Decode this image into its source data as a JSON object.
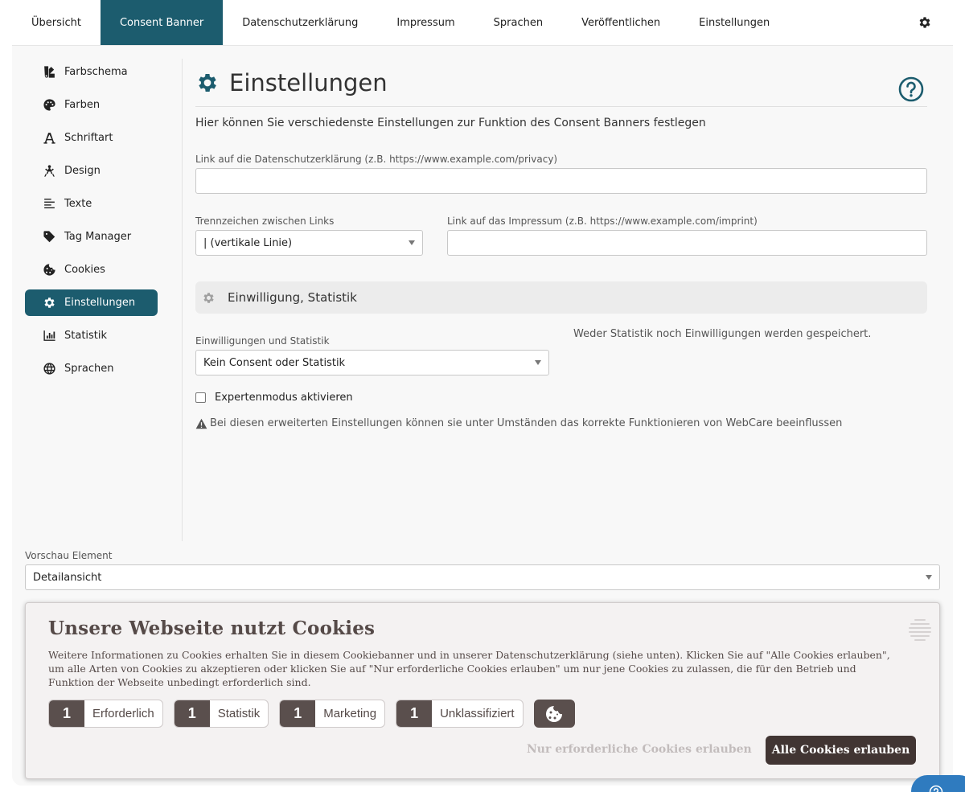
{
  "topnav": {
    "tabs": [
      {
        "label": "Übersicht"
      },
      {
        "label": "Consent Banner"
      },
      {
        "label": "Datenschutzerklärung"
      },
      {
        "label": "Impressum"
      },
      {
        "label": "Sprachen"
      },
      {
        "label": "Veröffentlichen"
      },
      {
        "label": "Einstellungen"
      }
    ],
    "active_tab": "Consent Banner",
    "settings_icon": "gear-icon"
  },
  "sidebar": {
    "items": [
      {
        "label": "Farbschema",
        "icon": "swatch-icon"
      },
      {
        "label": "Farben",
        "icon": "palette-icon"
      },
      {
        "label": "Schriftart",
        "icon": "font-icon"
      },
      {
        "label": "Design",
        "icon": "compass-drafting-icon"
      },
      {
        "label": "Texte",
        "icon": "align-left-icon"
      },
      {
        "label": "Tag Manager",
        "icon": "tag-icon"
      },
      {
        "label": "Cookies",
        "icon": "cookie-icon"
      },
      {
        "label": "Einstellungen",
        "icon": "gear-icon"
      },
      {
        "label": "Statistik",
        "icon": "bar-chart-icon"
      },
      {
        "label": "Sprachen",
        "icon": "globe-icon"
      }
    ],
    "active_item": "Einstellungen"
  },
  "content": {
    "title": "Einstellungen",
    "intro": "Hier können Sie verschiedenste Einstellungen zur Funktion des Consent Banners festlegen",
    "privacy_link_label": "Link auf die Datenschutzerklärung (z.B. https://www.example.com/privacy)",
    "privacy_link_value": "",
    "separator_label": "Trennzeichen zwischen Links",
    "separator_value": "| (vertikale Linie)",
    "imprint_link_label": "Link auf das Impressum (z.B. https://www.example.com/imprint)",
    "imprint_link_value": "",
    "section_title": "Einwilligung, Statistik",
    "consent_stats_label": "Einwilligungen und Statistik",
    "consent_stats_value": "Kein Consent oder Statistik",
    "consent_stats_note": "Weder Statistik noch Einwilligungen werden gespeichert.",
    "expert_mode_label": "Expertenmodus aktivieren",
    "expert_mode_checked": false,
    "expert_warning": "Bei diesen erweiterten Einstellungen können sie unter Umständen das korrekte Funktionieren von WebCare beeinflussen"
  },
  "preview": {
    "label": "Vorschau Element",
    "value": "Detailansicht"
  },
  "banner": {
    "title": "Unsere Webseite nutzt Cookies",
    "description": "Weitere Informationen zu Cookies erhalten Sie in diesem Cookiebanner und in unserer Datenschutzerklärung (siehe unten). Klicken Sie auf \"Alle Cookies erlauben\", um alle Arten von Cookies zu akzeptieren oder klicken Sie auf \"Nur erforderliche Cookies erlauben\" um nur jene Cookies zu zulassen, die für den Betrieb und Funktion der Webseite unbedingt erforderlich sind.",
    "categories": [
      {
        "count": "1",
        "label": "Erforderlich"
      },
      {
        "count": "1",
        "label": "Statistik"
      },
      {
        "count": "1",
        "label": "Marketing"
      },
      {
        "count": "1",
        "label": "Unklassifiziert"
      }
    ],
    "btn_necessary": "Nur erforderliche Cookies erlauben",
    "btn_all": "Alle Cookies erlauben",
    "colors": {
      "primary": "#413533",
      "text": "#554a48",
      "accent": "#1c5c6e"
    }
  }
}
